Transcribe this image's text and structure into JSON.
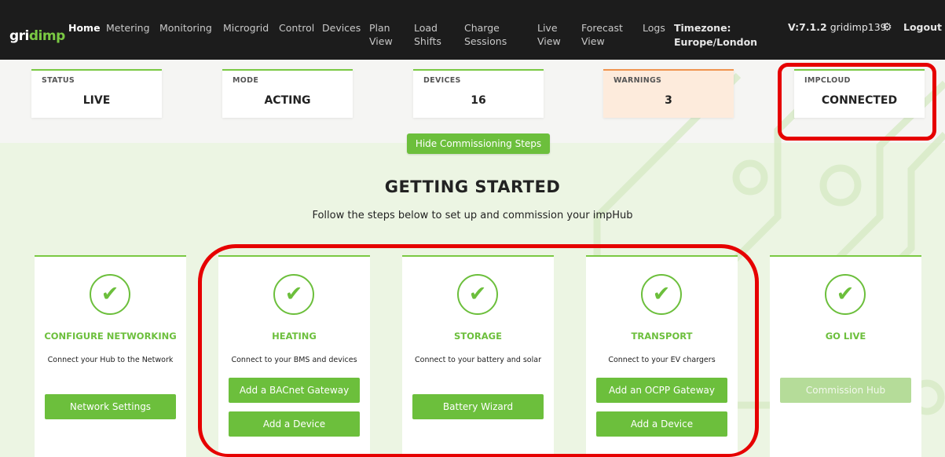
{
  "app": {
    "logo_prefix": "gri",
    "logo_suffix": "dimp"
  },
  "nav": {
    "items": [
      {
        "label": "Home",
        "active": true
      },
      {
        "label": "Metering"
      },
      {
        "label": "Monitoring"
      },
      {
        "label": "Microgrid"
      },
      {
        "label": "Control"
      },
      {
        "label": "Devices"
      },
      {
        "label": "Plan View"
      },
      {
        "label": "Load Shifts"
      },
      {
        "label": "Charge Sessions"
      },
      {
        "label": "Live View"
      },
      {
        "label": "Forecast View"
      },
      {
        "label": "Logs"
      }
    ],
    "timezone_label": "Timezone:",
    "timezone_value": "Europe/London",
    "version": "V:7.1.2",
    "user": "gridimp139",
    "logout": "Logout"
  },
  "status": [
    {
      "label": "STATUS",
      "value": "LIVE"
    },
    {
      "label": "MODE",
      "value": "ACTING"
    },
    {
      "label": "DEVICES",
      "value": "16"
    },
    {
      "label": "WARNINGS",
      "value": "3"
    },
    {
      "label": "IMPCLOUD",
      "value": "CONNECTED"
    }
  ],
  "commissioning": {
    "hide_button": "Hide Commissioning Steps",
    "title": "GETTING STARTED",
    "subtitle": "Follow the steps below to set up and commission your impHub"
  },
  "steps": [
    {
      "title": "CONFIGURE NETWORKING",
      "desc": "Connect your Hub to the Network",
      "buttons": [
        "Network Settings"
      ]
    },
    {
      "title": "HEATING",
      "desc": "Connect to your BMS and devices",
      "buttons": [
        "Add a BACnet Gateway",
        "Add a Device"
      ]
    },
    {
      "title": "STORAGE",
      "desc": "Connect to your battery and solar",
      "buttons": [
        "Battery Wizard"
      ]
    },
    {
      "title": "TRANSPORT",
      "desc": "Connect to your EV chargers",
      "buttons": [
        "Add an OCPP Gateway",
        "Add a Device"
      ]
    },
    {
      "title": "GO LIVE",
      "desc": "",
      "buttons": [
        "Commission Hub"
      ]
    }
  ],
  "colors": {
    "accent": "#6cbf3c",
    "navbar": "#1c1c1c",
    "warning": "#f0944f",
    "highlight": "#e60000"
  },
  "icons": {
    "check": "check-circle-icon",
    "settings": "gear-icon"
  }
}
